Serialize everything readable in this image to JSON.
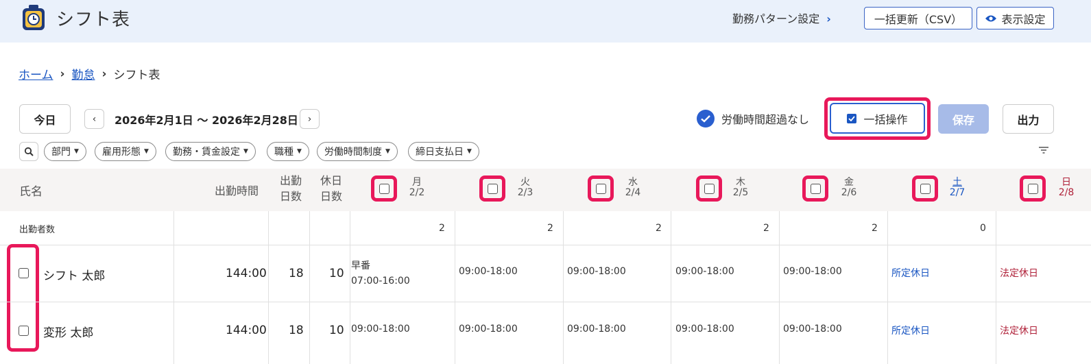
{
  "app": {
    "title": "シフト表",
    "icon": "timer-icon"
  },
  "topbar": {
    "pattern_link": "勤務パターン設定",
    "csv_button": "一括更新（CSV）",
    "display_button": "表示設定"
  },
  "breadcrumb": {
    "home": "ホーム",
    "attendance": "勤怠",
    "current": "シフト表"
  },
  "toolbar": {
    "today": "今日",
    "date_range": "2026年2月1日 〜 2026年2月28日",
    "overtime_label": "労働時間超過なし",
    "bulk_label": "一括操作",
    "bulk_checked": true,
    "save": "保存",
    "output": "出力"
  },
  "filters": [
    "部門",
    "雇用形態",
    "勤務・賃金設定",
    "職種",
    "労働時間制度",
    "締日支払日"
  ],
  "table": {
    "headers": {
      "name": "氏名",
      "work_time": "出勤時間",
      "work_days_1": "出勤",
      "work_days_2": "日数",
      "off_days_1": "休日",
      "off_days_2": "日数"
    },
    "days": [
      {
        "weekday": "月",
        "date": "2/2"
      },
      {
        "weekday": "火",
        "date": "2/3"
      },
      {
        "weekday": "水",
        "date": "2/4"
      },
      {
        "weekday": "木",
        "date": "2/5"
      },
      {
        "weekday": "金",
        "date": "2/6"
      },
      {
        "weekday": "土",
        "date": "2/7"
      },
      {
        "weekday": "日",
        "date": "2/8"
      }
    ],
    "count_row": {
      "label": "出勤者数",
      "counts": [
        "2",
        "2",
        "2",
        "2",
        "2",
        "0",
        ""
      ]
    },
    "rows": [
      {
        "name": "シフト 太郎",
        "work_time": "144:00",
        "work_days": "18",
        "off_days": "10",
        "shifts": [
          {
            "label": "早番",
            "time": "07:00-16:00"
          },
          {
            "label": "",
            "time": "09:00-18:00"
          },
          {
            "label": "",
            "time": "09:00-18:00"
          },
          {
            "label": "",
            "time": "09:00-18:00"
          },
          {
            "label": "",
            "time": "09:00-18:00"
          },
          {
            "label": "",
            "time": "所定休日"
          },
          {
            "label": "",
            "time": "法定休日"
          }
        ]
      },
      {
        "name": "変形 太郎",
        "work_time": "144:00",
        "work_days": "18",
        "off_days": "10",
        "shifts": [
          {
            "label": "",
            "time": "09:00-18:00"
          },
          {
            "label": "",
            "time": "09:00-18:00"
          },
          {
            "label": "",
            "time": "09:00-18:00"
          },
          {
            "label": "",
            "time": "09:00-18:00"
          },
          {
            "label": "",
            "time": "09:00-18:00"
          },
          {
            "label": "",
            "time": "所定休日"
          },
          {
            "label": "",
            "time": "法定休日"
          }
        ]
      }
    ]
  },
  "colors": {
    "accent": "#1a56c2",
    "highlight": "#e8185a",
    "holiday_red": "#b0223a",
    "header_bg": "#eaf1fb"
  }
}
